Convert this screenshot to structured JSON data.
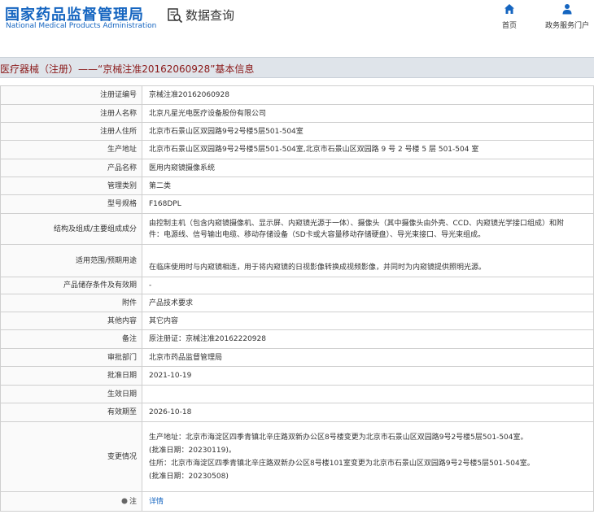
{
  "header": {
    "logo_cn": "国家药品监督管理局",
    "logo_en": "National Medical Products Administration",
    "data_query": "数据查询",
    "nav": [
      {
        "label": "首页",
        "icon": "home-icon"
      },
      {
        "label": "政务服务门户",
        "icon": "user-icon"
      }
    ]
  },
  "title": "医疗器械（注册）——“京械注准20162060928”基本信息",
  "rows": [
    {
      "key": "注册证编号",
      "lines": [
        "京械注准20162060928"
      ]
    },
    {
      "key": "注册人名称",
      "lines": [
        "北京凡星光电医疗设备股份有限公司"
      ]
    },
    {
      "key": "注册人住所",
      "lines": [
        "北京市石景山区双园路9号2号楼5层501-504室"
      ]
    },
    {
      "key": "生产地址",
      "lines": [
        "北京市石景山区双园路9号2号楼5层501-504室,北京市石景山区双园路 9 号 2 号楼 5 层 501-504 室"
      ]
    },
    {
      "key": "产品名称",
      "lines": [
        "医用内窥镜摄像系统"
      ]
    },
    {
      "key": "管理类别",
      "lines": [
        "第二类"
      ]
    },
    {
      "key": "型号规格",
      "lines": [
        "F168DPL"
      ]
    },
    {
      "key": "结构及组成/主要组成成分",
      "lines": [
        "由控制主机（包含内窥镜摄像机、显示屏、内窥镜光源于一体）、摄像头（其中摄像头由外壳、CCD、内窥镜光学接口组成）和附",
        "件：电源线、信号输出电缆、移动存储设备（SD卡或大容量移动存储硬盘）、导光束接口、导光束组成。"
      ]
    },
    {
      "key": "适用范围/预期用途",
      "lines": [
        "在临床使用时与内窥镜相连，用于将内窥镜的日视影像转换成视频影像，并同时为内窥镜提供照明光源。"
      ]
    },
    {
      "key": "产品储存条件及有效期",
      "lines": [
        "-"
      ]
    },
    {
      "key": "附件",
      "lines": [
        "产品技术要求"
      ]
    },
    {
      "key": "其他内容",
      "lines": [
        "其它内容"
      ]
    },
    {
      "key": "备注",
      "lines": [
        "原注册证：京械注准20162220928"
      ]
    },
    {
      "key": "审批部门",
      "lines": [
        "北京市药品监督管理局"
      ]
    },
    {
      "key": "批准日期",
      "lines": [
        "2021-10-19"
      ]
    },
    {
      "key": "生效日期",
      "lines": [
        ""
      ]
    },
    {
      "key": "有效期至",
      "lines": [
        "2026-10-18"
      ]
    },
    {
      "key": "变更情况",
      "lines": [
        "生产地址：北京市海淀区四季青镇北辛庄路双新办公区8号楼变更为北京市石景山区双园路9号2号楼5层501-504室。",
        "(批准日期：20230119)。",
        "住所：北京市海淀区四季青镇北辛庄路双新办公区8号楼101室变更为北京市石景山区双园路9号2号楼5层501-504室。",
        "(批准日期：20230508)"
      ]
    },
    {
      "key": "注",
      "lines": [
        "详情"
      ]
    }
  ]
}
